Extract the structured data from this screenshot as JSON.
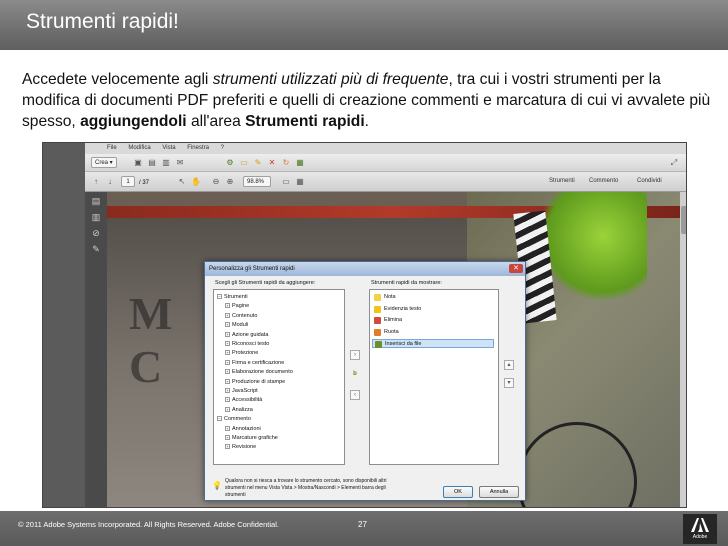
{
  "slide": {
    "title": "Strumenti rapidi!",
    "body": {
      "p1": "Accedete velocemente agli ",
      "p1_italic": "strumenti utilizzati più di frequente",
      "p2": ", tra cui i vostri strumenti per la modifica di documenti PDF preferiti e quelli di creazione commenti e marcatura di cui vi avvalete più spesso, ",
      "p2_bold1": "aggiungendoli",
      "p3": " all'area ",
      "p3_bold2": "Strumenti rapidi",
      "p4": "."
    },
    "footer": {
      "copyright": "© 2011 Adobe Systems Incorporated.  All Rights Reserved.  Adobe Confidential.",
      "page_number": "27",
      "logo_text": "Adobe"
    }
  },
  "app": {
    "menubar": [
      "File",
      "Modifica",
      "Vista",
      "Finestra",
      "?"
    ],
    "toolbar": {
      "create_button": "Crea",
      "page_current": "1",
      "page_total": "/ 37",
      "zoom": "98.8%"
    },
    "right_tabs": [
      "Strumenti",
      "Commento",
      "Condividi"
    ]
  },
  "dialog": {
    "title": "Personalizza gli Strumenti rapidi",
    "left_label": "Scegli gli Strumenti rapidi da aggiungere:",
    "right_label": "Strumenti rapidi da mostrare:",
    "left_tree": [
      {
        "label": "Strumenti",
        "level": 0,
        "expander": "−"
      },
      {
        "label": "Pagine",
        "level": 1,
        "expander": "+"
      },
      {
        "label": "Contenuto",
        "level": 1,
        "expander": "+"
      },
      {
        "label": "Moduli",
        "level": 1,
        "expander": "+"
      },
      {
        "label": "Azione guidata",
        "level": 1,
        "expander": "+"
      },
      {
        "label": "Riconosci testo",
        "level": 1,
        "expander": "+"
      },
      {
        "label": "Protezione",
        "level": 1,
        "expander": "+"
      },
      {
        "label": "Firma e certificazione",
        "level": 1,
        "expander": "+"
      },
      {
        "label": "Elaborazione documento",
        "level": 1,
        "expander": "+"
      },
      {
        "label": "Produzione di stampe",
        "level": 1,
        "expander": "+"
      },
      {
        "label": "JavaScript",
        "level": 1,
        "expander": "+"
      },
      {
        "label": "Accessibilità",
        "level": 1,
        "expander": "+"
      },
      {
        "label": "Analizza",
        "level": 1,
        "expander": "+"
      },
      {
        "label": "Commento",
        "level": 0,
        "expander": "−"
      },
      {
        "label": "Annotazioni",
        "level": 1,
        "expander": "+"
      },
      {
        "label": "Marcature grafiche",
        "level": 1,
        "expander": "+"
      },
      {
        "label": "Revisione",
        "level": 1,
        "expander": "+"
      }
    ],
    "right_list": [
      {
        "label": "Nota",
        "icon": "note-icon",
        "color": "#f2d24a",
        "selected": false
      },
      {
        "label": "Evidenzia testo",
        "icon": "highlight-icon",
        "color": "#f0c419",
        "selected": false
      },
      {
        "label": "Elimina",
        "icon": "delete-icon",
        "color": "#d44a3a",
        "selected": false
      },
      {
        "label": "Ruota",
        "icon": "rotate-icon",
        "color": "#e07f2b",
        "selected": false
      },
      {
        "label": "Inserisci da file",
        "icon": "insert-from-file-icon",
        "color": "#6d8f2a",
        "selected": true
      }
    ],
    "hint": "Qualora non si riesca a trovare lo strumento cercato, sono disponibili altri strumenti nel menu Vista Vista > Mostra/Nascondi > Elementi barra degli strumenti",
    "ok_label": "OK",
    "cancel_label": "Annulla"
  },
  "colors": {
    "title_band": "#6f6f6f",
    "footer": "#5a5a5a",
    "dialog_selection": "#cfe3f7"
  }
}
